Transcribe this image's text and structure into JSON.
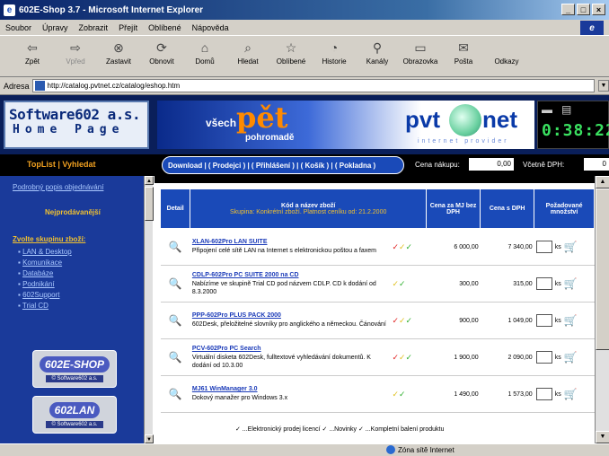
{
  "window": {
    "title": "602E-Shop 3.7 - Microsoft Internet Explorer"
  },
  "menu": [
    "Soubor",
    "Úpravy",
    "Zobrazit",
    "Přejít",
    "Oblíbené",
    "Nápověda"
  ],
  "toolbar": [
    {
      "label": "Zpět",
      "icon": "back-arrow-icon",
      "enabled": true
    },
    {
      "label": "Vpřed",
      "icon": "forward-arrow-icon",
      "enabled": false
    },
    {
      "label": "Zastavit",
      "icon": "stop-icon",
      "enabled": true
    },
    {
      "label": "Obnovit",
      "icon": "refresh-icon",
      "enabled": true
    },
    {
      "label": "Domů",
      "icon": "home-icon",
      "enabled": true
    },
    {
      "label": "Hledat",
      "icon": "search-icon",
      "enabled": true
    },
    {
      "label": "Oblíbené",
      "icon": "favorites-icon",
      "enabled": true
    },
    {
      "label": "Historie",
      "icon": "history-icon",
      "enabled": true
    },
    {
      "label": "Kanály",
      "icon": "channels-icon",
      "enabled": true
    },
    {
      "label": "Obrazovka",
      "icon": "fullscreen-icon",
      "enabled": true
    },
    {
      "label": "Pošta",
      "icon": "mail-icon",
      "enabled": true
    },
    {
      "label": "Odkazy",
      "icon": "",
      "enabled": true
    }
  ],
  "address": {
    "label": "Adresa",
    "url": "http://catalog.pvtnet.cz/catalog/eshop.htm"
  },
  "header": {
    "logo_line1": "Software602 a.s.",
    "logo_line2": "Home Page",
    "banner": {
      "vsech": "všech",
      "pet": "pět",
      "pohr": "pohromadě",
      "brand_a": "pvt",
      "brand_b": "net",
      "provider": "internet provider"
    },
    "clock": "0:38:22"
  },
  "nav": {
    "toplist": "TopList  |  Vyhledat",
    "tabs": "Download | ( Prodejci ) | ( Přihlášení ) | ( Košík ) | ( Pokladna )",
    "cena_label": "Cena nákupu:",
    "cena_value": "0,00",
    "vcetne_label": "Včetně DPH:",
    "vcetne_value": "0"
  },
  "sidebar": {
    "podrobny": "Podrobný popis objednávání",
    "nejprodavanejsi": "Nejprodávanější",
    "zvolte": "Zvolte skupinu zboží:",
    "groups": [
      "LAN & Desktop",
      "Komunikace",
      "Databáze",
      "Podnikání",
      "602Support",
      "Trial CD"
    ],
    "badge1": {
      "title": "602E-SHOP",
      "sub": "© Software602 a.s."
    },
    "badge2": {
      "title": "602LAN",
      "sub": "© Software602 a.s."
    }
  },
  "table": {
    "col_detail": "Detail",
    "col_name": "Kód a název zboží",
    "col_name_sub": "Skupina: Konkrétní zboží.  Platnost ceníku od: 21.2.2000",
    "col_price": "Cena za MJ bez DPH",
    "col_vat": "Cena s DPH",
    "col_qty": "Požadované množství",
    "unit": "ks",
    "rows": [
      {
        "code": "XLAN-602Pro LAN SUITE",
        "desc": "Připojení celé sítě LAN na Internet s elektronickou poštou a faxem",
        "price": "6 000,00",
        "price_vat": "7 340,00",
        "checks": [
          "r",
          "y",
          "g"
        ]
      },
      {
        "code": "CDLP-602Pro PC SUITE 2000 na CD",
        "desc": "Nabízíme ve skupině Trial CD pod názvem CDLP. CD k dodání od 8.3.2000",
        "price": "300,00",
        "price_vat": "315,00",
        "checks": [
          "y",
          "g"
        ]
      },
      {
        "code": "PPP-602Pro PLUS PACK 2000",
        "desc": "602Desk, přeložitelné slovníky pro anglického a německou. Čánování",
        "price": "900,00",
        "price_vat": "1 049,00",
        "checks": [
          "r",
          "y",
          "g"
        ]
      },
      {
        "code": "PCV-602Pro PC Search",
        "desc": "Virtuální disketa 602Desk, fulltextové vyhledávání dokumentů. K dodání od 10.3.00",
        "price": "1 900,00",
        "price_vat": "2 090,00",
        "checks": [
          "r",
          "y",
          "g"
        ]
      },
      {
        "code": "MJ61 WinManager 3.0",
        "desc": "Dokový manažer pro Windows 3.x",
        "price": "1 490,00",
        "price_vat": "1 573,00",
        "checks": [
          "y",
          "g"
        ]
      }
    ],
    "legend": "✓ ...Elektronický prodej licencí   ✓ ...Novinky   ✓ ...Kompletní balení produktu"
  },
  "status": {
    "left": "",
    "zone": "Zóna sítě Internet"
  }
}
